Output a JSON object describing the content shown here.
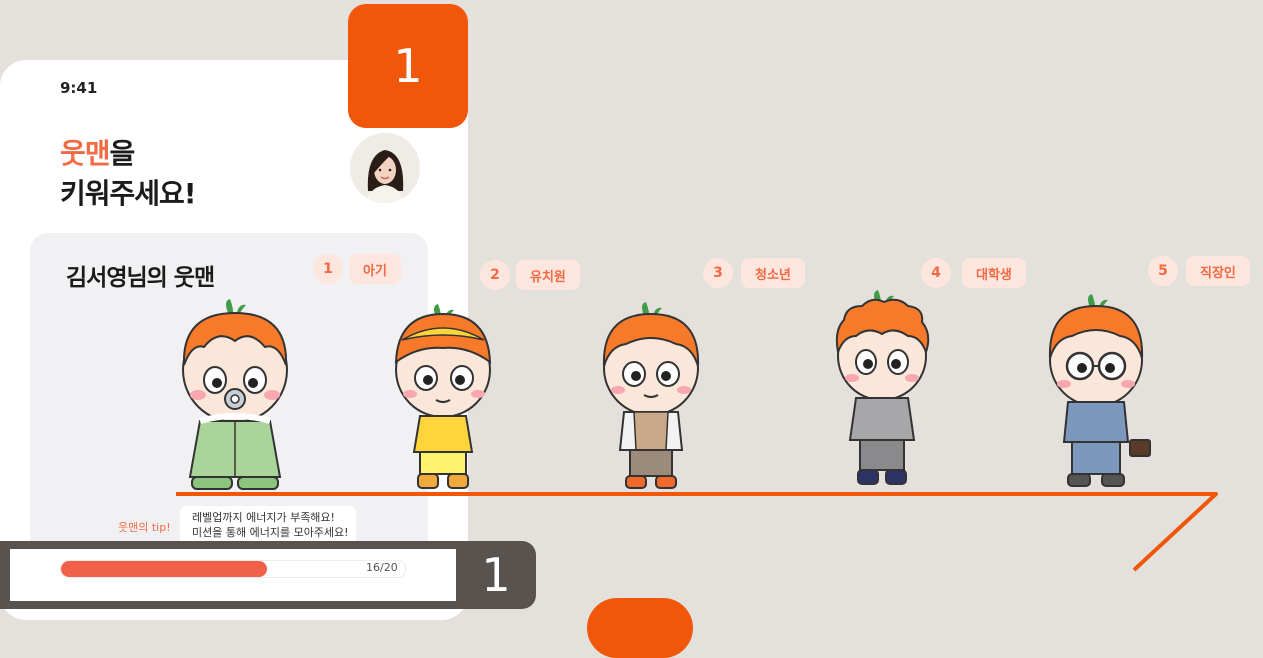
{
  "status_bar": {
    "time": "9:41"
  },
  "header": {
    "title_accent": "웃맨",
    "title_rest": "을",
    "title_line2": "키워주세요!"
  },
  "card": {
    "title": "김서영님의 웃맨",
    "level": "1",
    "stage": "아기",
    "tip_label": "웃맨의 tip!",
    "tip_line1": "레벨업까지 에너지가 부족해요!",
    "tip_line2": "미션을 통해 에너지를 모아주세요!",
    "progress_text": "16/20",
    "progress_value": 0.6
  },
  "callouts": {
    "top": "1",
    "bottom": "1"
  },
  "stages": [
    {
      "num": "2",
      "label": "유치원"
    },
    {
      "num": "3",
      "label": "청소년"
    },
    {
      "num": "4",
      "label": "대학생"
    },
    {
      "num": "5",
      "label": "직장인"
    }
  ],
  "colors": {
    "accent": "#f26a44",
    "callout": "#f0570b",
    "timeline": "#f0570b",
    "background": "#e4e1dc"
  },
  "icons": {
    "avatar": "user-avatar-photo"
  }
}
